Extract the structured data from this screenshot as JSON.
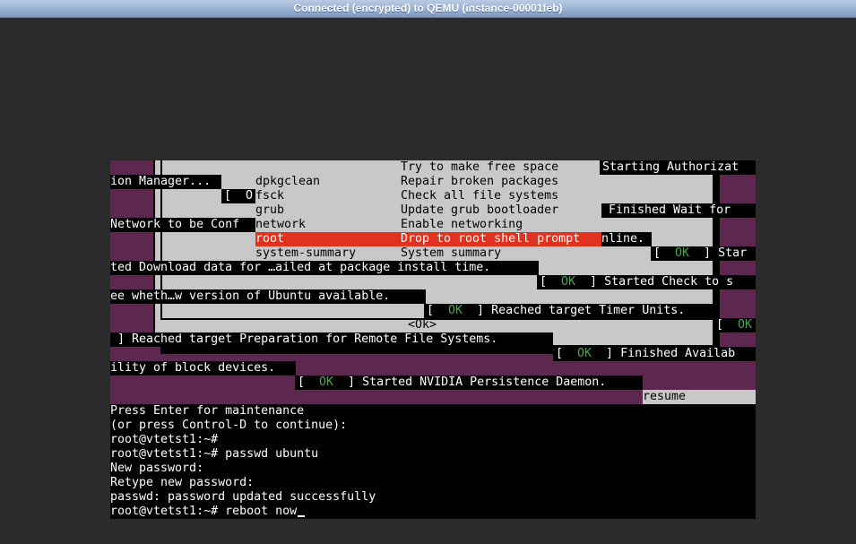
{
  "window": {
    "title": "Connected (encrypted) to QEMU (instance-00001feb)"
  },
  "recovery_menu": {
    "items": [
      {
        "name": "clean",
        "desc": "Try to make free space"
      },
      {
        "name": "dpkg",
        "desc": "Repair broken packages"
      },
      {
        "name": "fsck",
        "desc": "Check all file systems"
      },
      {
        "name": "grub",
        "desc": "Update grub bootloader"
      },
      {
        "name": "network",
        "desc": "Enable networking"
      },
      {
        "name": "root",
        "desc": "Drop to root shell prompt",
        "selected": true
      },
      {
        "name": "system-summary",
        "desc": "System summary"
      }
    ],
    "ok_button": "<Ok>",
    "resume_field": "resume"
  },
  "boot_log": {
    "ok_tag": "OK",
    "r1_right": "Starting Authorizat",
    "r2_left": "ion Manager...",
    "r3_frag": "[  O",
    "r4_right": "Finished Wait for",
    "r5_left": "Network to be Conf",
    "r6_tail": "nline.",
    "r7_right": "Star",
    "r8_left": "ted Download data for …ailed at package install time.",
    "r9_right": "Started Check to s",
    "r10_left": "ee wheth…w version of Ubuntu available.",
    "r11_text": "Reached target Timer Units.",
    "r12_left": "] Reached target Preparation for Remote File Systems.",
    "r13_right": "Finished Availab",
    "r14_left": "ility of block devices.",
    "r15_text": "Started NVIDIA Persistence Daemon."
  },
  "shell": {
    "lines": [
      "Press Enter for maintenance",
      "(or press Control-D to continue):",
      "root@vtetst1:~#",
      "root@vtetst1:~# passwd ubuntu",
      "New password:",
      "Retype new password:",
      "passwd: password updated successfully"
    ],
    "current_input": "root@vtetst1:~# reboot now"
  },
  "colors": {
    "ubuntu_purple": "#5e2750",
    "dialog_gray": "#c8c8c8",
    "selection_red": "#e0321e",
    "ok_green": "#4aa84a"
  }
}
